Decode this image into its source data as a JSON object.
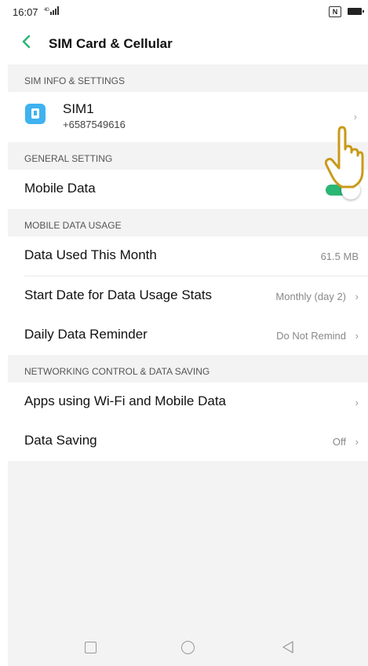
{
  "status_bar": {
    "time": "16:07",
    "signal": "4G",
    "nfc": "N"
  },
  "header": {
    "title": "SIM Card & Cellular"
  },
  "sections": {
    "sim_info": {
      "header": "SIM INFO & SETTINGS",
      "sim": {
        "name": "SIM1",
        "number": "+6587549616"
      }
    },
    "general": {
      "header": "GENERAL SETTING",
      "mobile_data_label": "Mobile Data",
      "mobile_data_on": true
    },
    "usage": {
      "header": "MOBILE DATA USAGE",
      "data_used_label": "Data Used This Month",
      "data_used_value": "61.5 MB",
      "start_date_label": "Start Date for Data Usage Stats",
      "start_date_value": "Monthly (day 2)",
      "reminder_label": "Daily Data Reminder",
      "reminder_value": "Do Not Remind"
    },
    "networking": {
      "header": "NETWORKING CONTROL & DATA SAVING",
      "apps_label": "Apps using Wi-Fi and Mobile Data",
      "saving_label": "Data Saving",
      "saving_value": "Off"
    }
  },
  "chevron": "›",
  "colors": {
    "toggle_on": "#2bb673",
    "sim_icon": "#3fb2f0",
    "back_arrow": "#2bb673",
    "hand": "#c99a1a"
  }
}
